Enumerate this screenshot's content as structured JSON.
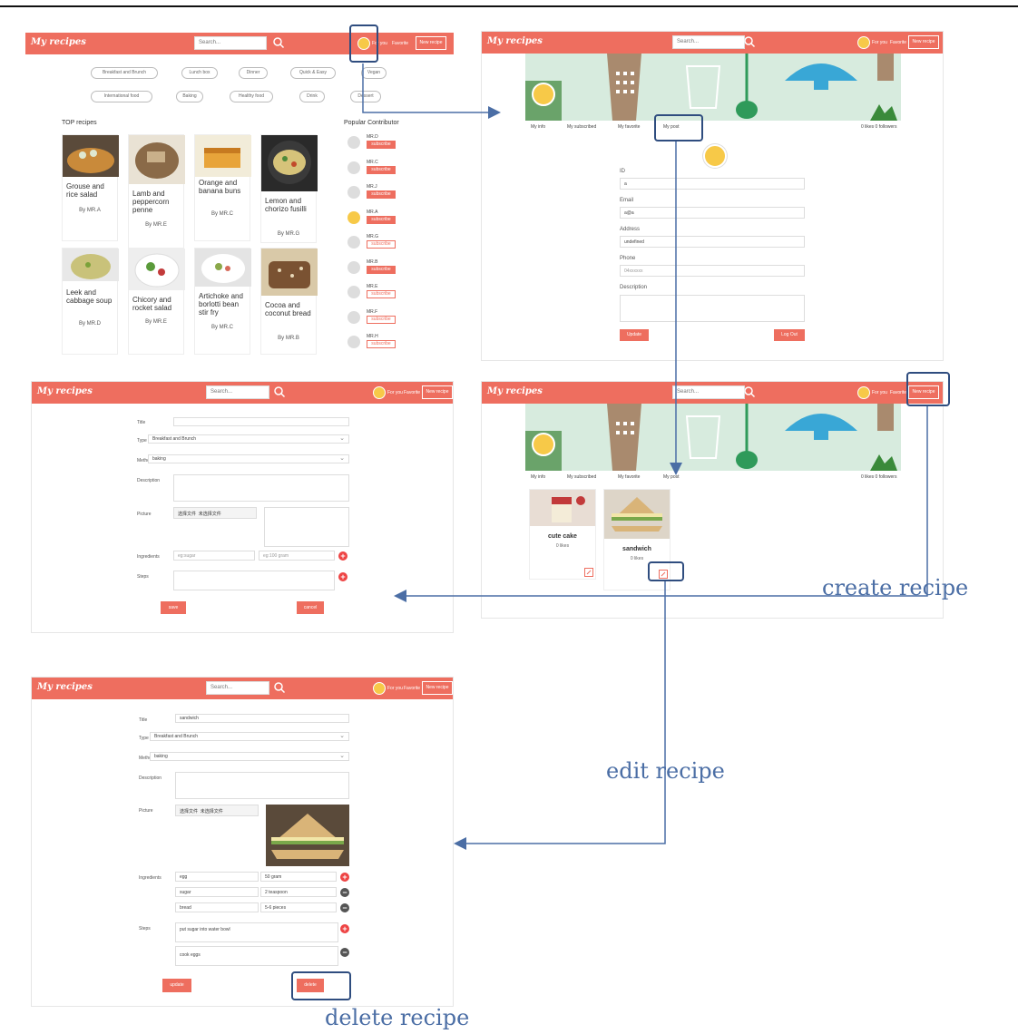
{
  "app": {
    "brand": "My recipes",
    "search_placeholder": "Search...",
    "nav_for_you": "For you",
    "nav_favorite": "Favorite",
    "nav_new_recipe": "New recipe"
  },
  "colors": {
    "accent": "#ee6e5f",
    "highlight": "#2f4d7f",
    "annotation": "#4b6ea5"
  },
  "home": {
    "categories": [
      "Breakfast and Brunch",
      "Lunch box",
      "Dinner",
      "Quick & Easy",
      "Vegan",
      "International food",
      "Baking",
      "Healthy food",
      "Drink",
      "Dessert"
    ],
    "top_title": "TOP recipes",
    "contrib_title": "Popular Contributor",
    "recipes": [
      {
        "title": "Grouse and rice salad",
        "by": "By MR.A"
      },
      {
        "title": "Lamb and peppercorn penne",
        "by": "By MR.E"
      },
      {
        "title": "Orange and banana buns",
        "by": "By MR.C"
      },
      {
        "title": "Lemon and chorizo fusilli",
        "by": "By MR.G"
      },
      {
        "title": "Leek and cabbage soup",
        "by": "By MR.D"
      },
      {
        "title": "Chicory and rocket salad",
        "by": "By MR.E"
      },
      {
        "title": "Artichoke and borlotti bean stir fry",
        "by": "By MR.C"
      },
      {
        "title": "Cocoa and coconut bread",
        "by": "By MR.B"
      }
    ],
    "contributors": [
      {
        "name": "MR.D",
        "button": "subscribe",
        "subscribed": true
      },
      {
        "name": "MR.C",
        "button": "subscribe",
        "subscribed": true
      },
      {
        "name": "MR.J",
        "button": "subscribe",
        "subscribed": true
      },
      {
        "name": "MR.A",
        "button": "subscribe",
        "subscribed": true
      },
      {
        "name": "MR.G",
        "button": "subscribe",
        "subscribed": false
      },
      {
        "name": "MR.B",
        "button": "subscribe",
        "subscribed": true
      },
      {
        "name": "MR.E",
        "button": "subscribe",
        "subscribed": false
      },
      {
        "name": "MR.F",
        "button": "subscribe",
        "subscribed": false
      },
      {
        "name": "MR.H",
        "button": "subscribe",
        "subscribed": false
      }
    ]
  },
  "profile": {
    "tabs": [
      "My info",
      "My subscribed",
      "My favorite",
      "My post"
    ],
    "stats": "0 likes  0 followers",
    "fields": [
      {
        "label": "ID",
        "value": "a"
      },
      {
        "label": "Email",
        "value": "a@a"
      },
      {
        "label": "Address",
        "value": "undefined"
      },
      {
        "label": "Phone",
        "value": "04xxxxxx"
      }
    ],
    "description_label": "Description",
    "update": "Update",
    "logout": "Log Out"
  },
  "posts": {
    "items": [
      {
        "title": "cute cake",
        "likes": "0 likes"
      },
      {
        "title": "sandwich",
        "likes": "0 likes"
      }
    ]
  },
  "create_form": {
    "labels": {
      "title": "Title",
      "type": "Type",
      "method": "Method",
      "description": "Description",
      "picture": "Picture",
      "ingredients": "Ingredients",
      "steps": "Steps"
    },
    "type_value": "Breakfast and Brunch",
    "method_value": "baking",
    "file_button": "选择文件",
    "file_status": "未选择文件",
    "ingredient_placeholder": "eg:sugar",
    "amount_placeholder": "eg:100 gram",
    "save": "save",
    "cancel": "cancel"
  },
  "edit_form": {
    "title_value": "sandwich",
    "type_value": "Breakfast and Brunch",
    "method_value": "baking",
    "ingredients": [
      {
        "name": "egg",
        "amount": "50 gram"
      },
      {
        "name": "sugar",
        "amount": "2 teaspoon"
      },
      {
        "name": "bread",
        "amount": "5-6 pieces"
      }
    ],
    "steps": [
      "put sugar into water bowl",
      "cook eggs"
    ],
    "update": "update",
    "delete": "delete"
  },
  "annotations": {
    "create": "create recipe",
    "edit": "edit recipe",
    "delete": "delete recipe"
  }
}
